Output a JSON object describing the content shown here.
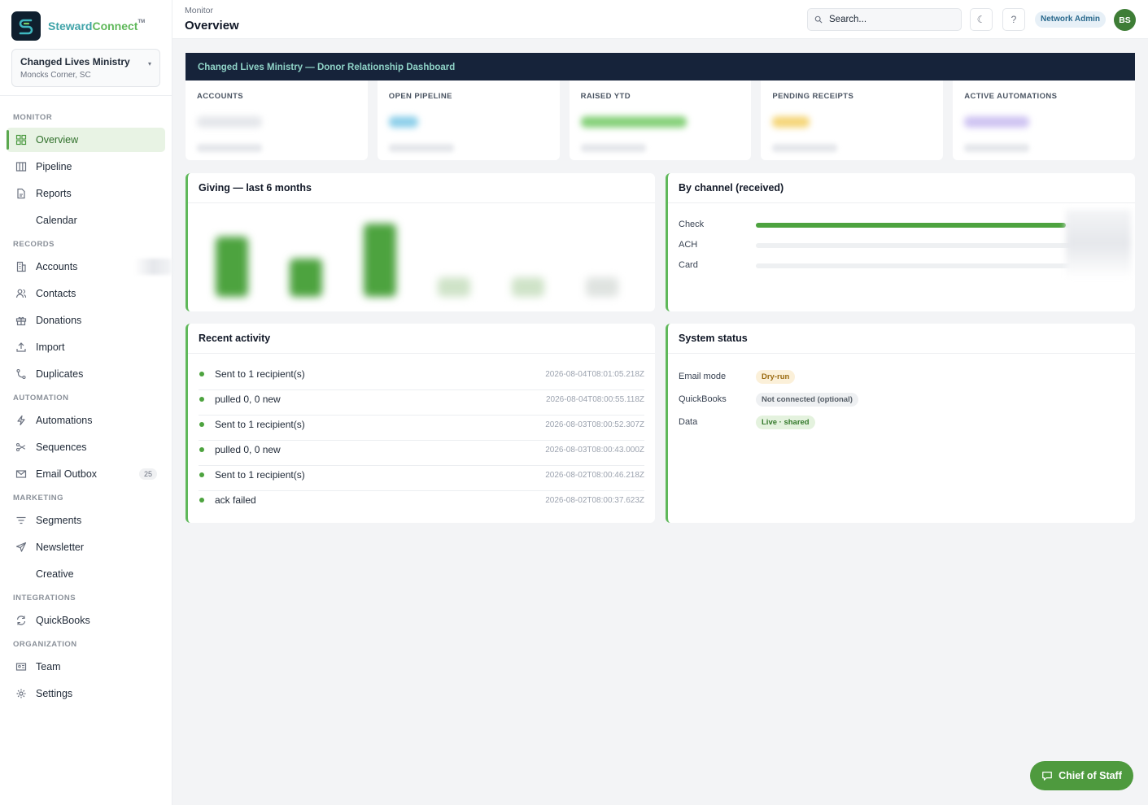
{
  "brand": {
    "name_part1": "Steward",
    "name_part2": "Connect",
    "trademark": "TM"
  },
  "org": {
    "name": "Changed Lives Ministry",
    "location": "Moncks Corner, SC"
  },
  "sidebar": {
    "sections": [
      {
        "title": "MONITOR",
        "items": [
          {
            "label": "Overview",
            "icon": "grid-icon",
            "active": true
          },
          {
            "label": "Pipeline",
            "icon": "columns-icon"
          },
          {
            "label": "Reports",
            "icon": "file-icon"
          },
          {
            "label": "Calendar",
            "icon": ""
          }
        ]
      },
      {
        "title": "RECORDS",
        "items": [
          {
            "label": "Accounts",
            "icon": "building-icon"
          },
          {
            "label": "Contacts",
            "icon": "users-icon"
          },
          {
            "label": "Donations",
            "icon": "gift-icon"
          },
          {
            "label": "Import",
            "icon": "upload-icon"
          },
          {
            "label": "Duplicates",
            "icon": "merge-icon"
          }
        ]
      },
      {
        "title": "AUTOMATION",
        "items": [
          {
            "label": "Automations",
            "icon": "bolt-icon"
          },
          {
            "label": "Sequences",
            "icon": "share-icon"
          },
          {
            "label": "Email Outbox",
            "icon": "mail-icon",
            "badge": "25"
          }
        ]
      },
      {
        "title": "MARKETING",
        "items": [
          {
            "label": "Segments",
            "icon": "filter-icon"
          },
          {
            "label": "Newsletter",
            "icon": "send-icon"
          },
          {
            "label": "Creative",
            "icon": ""
          }
        ]
      },
      {
        "title": "INTEGRATIONS",
        "items": [
          {
            "label": "QuickBooks",
            "icon": "sync-icon"
          }
        ]
      },
      {
        "title": "ORGANIZATION",
        "items": [
          {
            "label": "Team",
            "icon": "id-card-icon"
          },
          {
            "label": "Settings",
            "icon": "gear-icon"
          }
        ]
      }
    ]
  },
  "header": {
    "breadcrumb": "Monitor",
    "title": "Overview",
    "search_placeholder": "Search...",
    "theme_icon": "☾",
    "help_icon": "?",
    "role": "Network Admin",
    "avatar_initials": "BS"
  },
  "banner": {
    "text": "Changed Lives Ministry — Donor Relationship Dashboard"
  },
  "stats": [
    {
      "label": "ACCOUNTS",
      "color": "#e5e7eb"
    },
    {
      "label": "OPEN PIPELINE",
      "color": "#8fd0ea"
    },
    {
      "label": "RAISED YTD",
      "color": "#86d17a"
    },
    {
      "label": "PENDING RECEIPTS",
      "color": "#f5d67a"
    },
    {
      "label": "ACTIVE AUTOMATIONS",
      "color": "#cfc4f2"
    }
  ],
  "giving": {
    "title": "Giving — last 6 months",
    "chart_data": {
      "type": "bar",
      "values": [
        0.82,
        0.52,
        1.0,
        0.22,
        0.22,
        0.2
      ],
      "value_unit": "fraction of tallest bar",
      "colors": [
        "#4da33f",
        "#4da33f",
        "#4da33f",
        "#cfe3c8",
        "#cfe3c8",
        "#dfe3e0"
      ]
    }
  },
  "channels": {
    "title": "By channel (received)",
    "rows": [
      {
        "label": "Check",
        "share": 0.93
      },
      {
        "label": "ACH",
        "share": 0
      },
      {
        "label": "Card",
        "share": 0
      }
    ]
  },
  "activity": {
    "title": "Recent activity",
    "items": [
      {
        "text": "Sent to 1 recipient(s)",
        "time": "2026-08-04T08:01:05.218Z"
      },
      {
        "text": "pulled 0, 0 new",
        "time": "2026-08-04T08:00:55.118Z"
      },
      {
        "text": "Sent to 1 recipient(s)",
        "time": "2026-08-03T08:00:52.307Z"
      },
      {
        "text": "pulled 0, 0 new",
        "time": "2026-08-03T08:00:43.000Z"
      },
      {
        "text": "Sent to 1 recipient(s)",
        "time": "2026-08-02T08:00:46.218Z"
      },
      {
        "text": "ack failed",
        "time": "2026-08-02T08:00:37.623Z"
      }
    ]
  },
  "system": {
    "title": "System status",
    "rows": [
      {
        "label": "Email mode",
        "value": "Dry-run",
        "tone": "amber"
      },
      {
        "label": "QuickBooks",
        "value": "Not connected (optional)",
        "tone": "gray"
      },
      {
        "label": "Data",
        "value": "Live · shared",
        "tone": "green"
      }
    ]
  },
  "chief_of_staff": {
    "label": "Chief of Staff"
  }
}
